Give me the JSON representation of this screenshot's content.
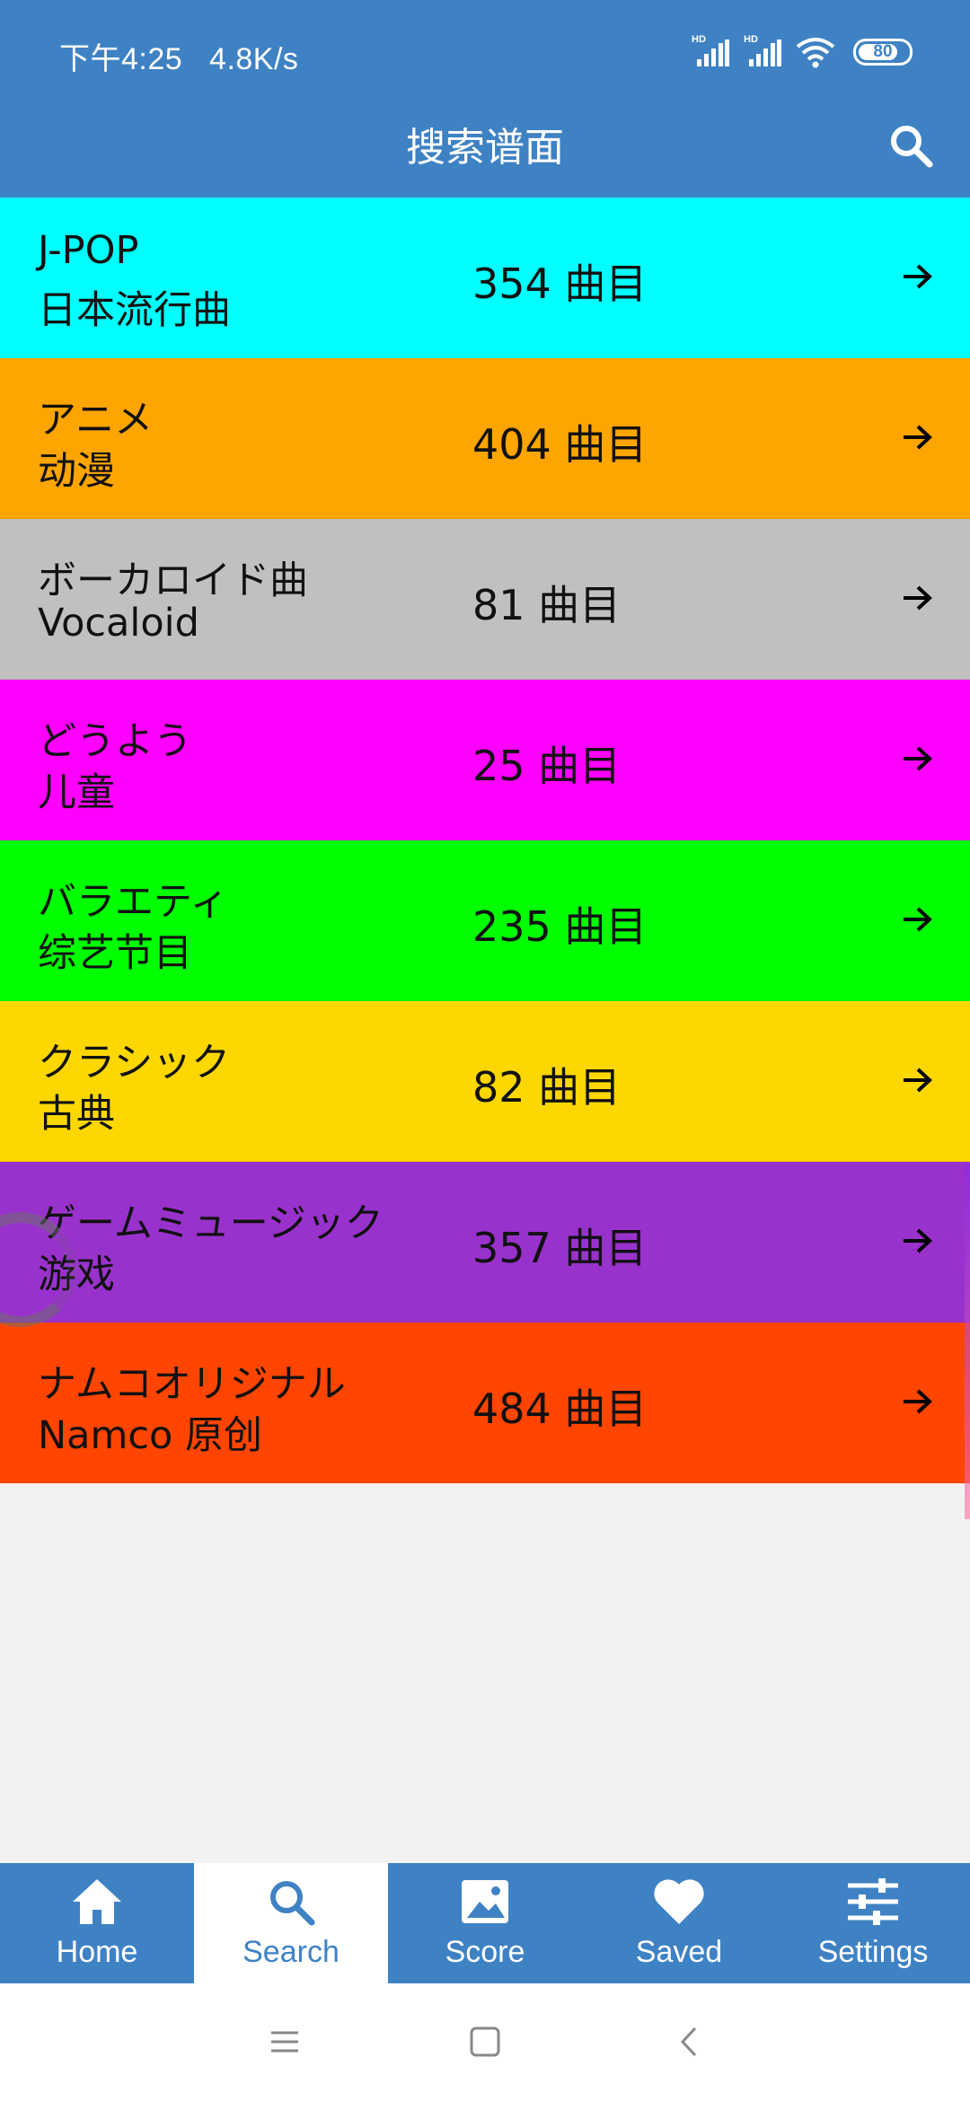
{
  "status_bar": {
    "time": "下午4:25",
    "speed": "4.8K/s",
    "signal1_label": "HD",
    "signal2_label": "HD",
    "battery_level": "80",
    "battery_fraction": 0.8
  },
  "app_bar": {
    "title": "搜索谱面",
    "search_icon": "search-icon"
  },
  "genres": [
    {
      "line1": "J-POP",
      "line2": "日本流行曲",
      "count": "354 曲目",
      "color": "#00ffff"
    },
    {
      "line1": "アニメ",
      "line2": "动漫",
      "count": "404 曲目",
      "color": "#ffa500"
    },
    {
      "line1": "ボーカロイド曲",
      "line2": "Vocaloid",
      "count": "81 曲目",
      "color": "#c0c0c0"
    },
    {
      "line1": "どうよう",
      "line2": "儿童",
      "count": "25 曲目",
      "color": "#ff00ff"
    },
    {
      "line1": "バラエティ",
      "line2": "综艺节目",
      "count": "235 曲目",
      "color": "#00ff00"
    },
    {
      "line1": "クラシック",
      "line2": "古典",
      "count": "82 曲目",
      "color": "#ffd700"
    },
    {
      "line1": "ゲームミュージック",
      "line2": "游戏",
      "count": "357 曲目",
      "color": "#9932cc"
    },
    {
      "line1": "ナムコオリジナル",
      "line2": "Namco 原创",
      "count": "484 曲目",
      "color": "#ff4500"
    }
  ],
  "tabs": [
    {
      "label": "Home",
      "icon": "home-icon",
      "active": false
    },
    {
      "label": "Search",
      "icon": "search-icon",
      "active": true
    },
    {
      "label": "Score",
      "icon": "image-icon",
      "active": false
    },
    {
      "label": "Saved",
      "icon": "heart-icon",
      "active": false
    },
    {
      "label": "Settings",
      "icon": "sliders-icon",
      "active": false
    }
  ],
  "colors": {
    "primary": "#3f82c4",
    "background": "#f2f2f2"
  }
}
